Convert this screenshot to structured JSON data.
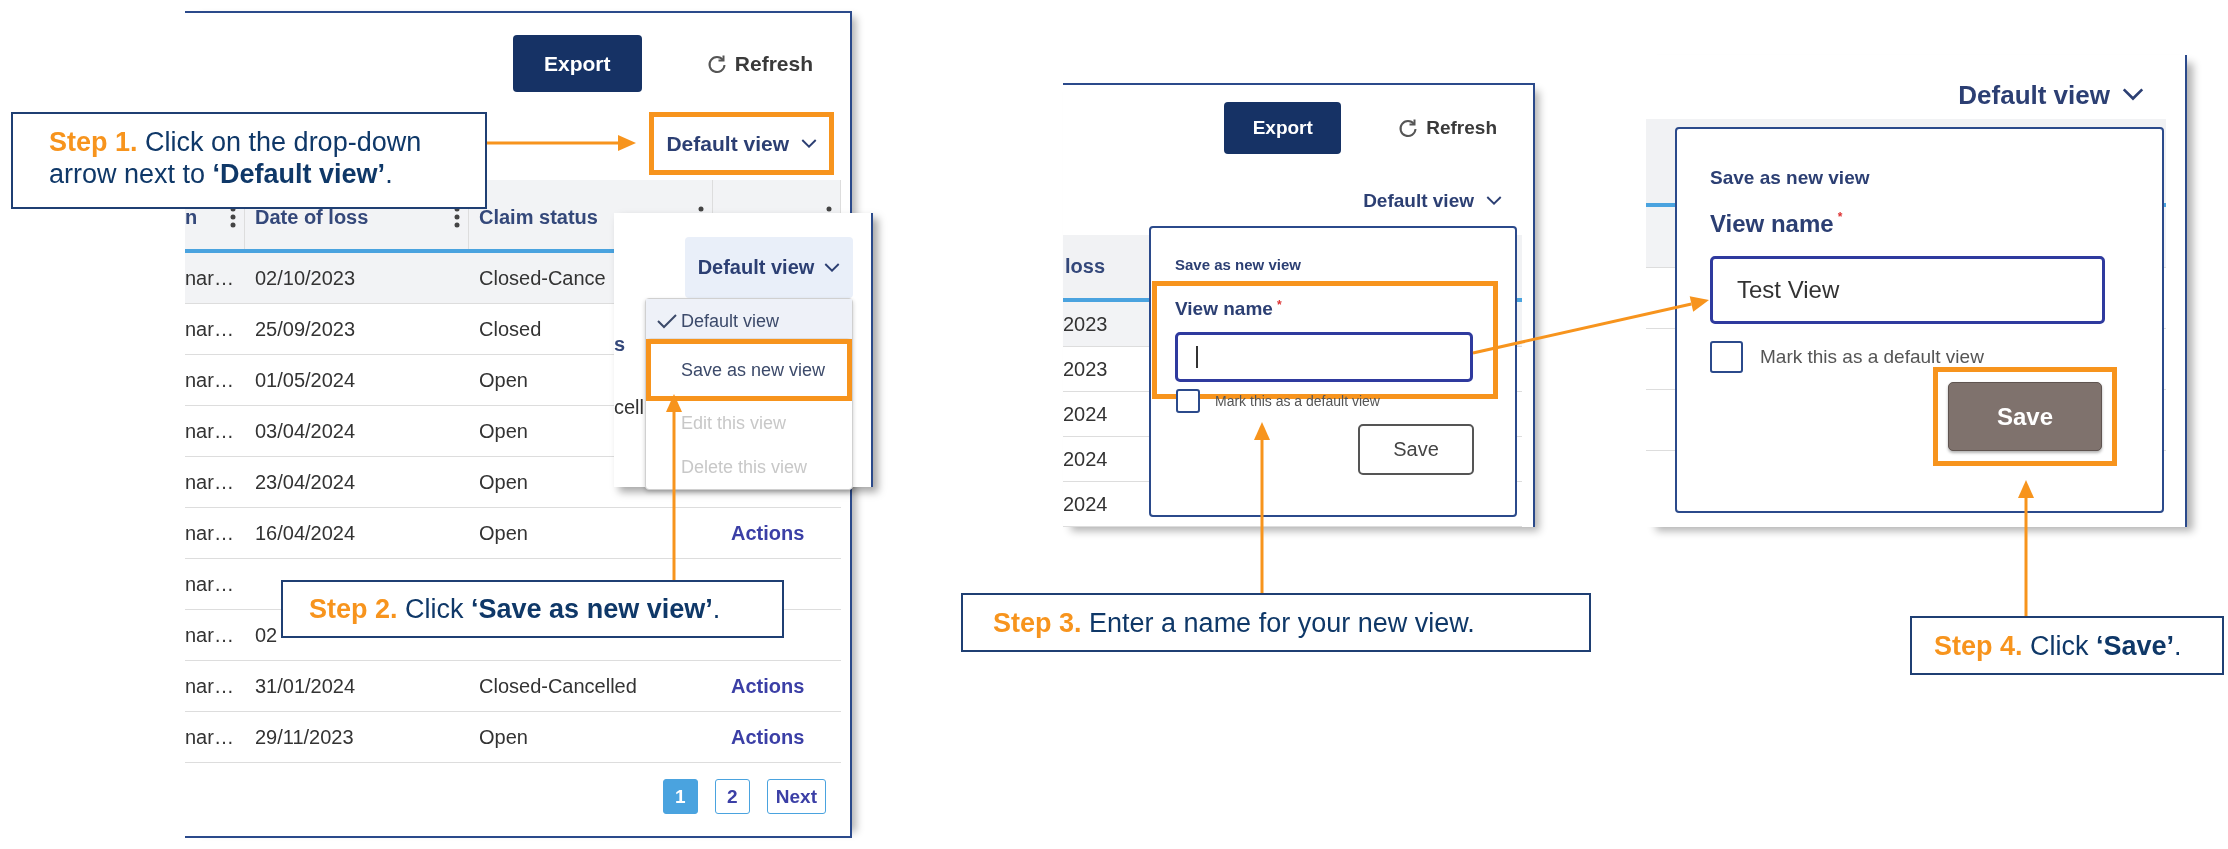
{
  "guide_steps": [
    {
      "label": "Step 1.",
      "text": "Click on the drop-down arrow next to **‘Default view’**."
    },
    {
      "label": "Step 2.",
      "text": "Click **‘Save as new view’**."
    },
    {
      "label": "Step 3.",
      "text": "Enter a name for your new view."
    },
    {
      "label": "Step 4.",
      "text": "Click **‘Save’**."
    }
  ],
  "screen_1": {
    "export_button": "Export",
    "refresh_button": "Refresh",
    "view_selector": {
      "label": "Default view",
      "highlighted": true
    },
    "table": {
      "columns": [
        "n",
        "Date of loss",
        "Claim status"
      ],
      "rows": [
        {
          "cells": [
            "nar…",
            "02/10/2023",
            "Closed-Cance"
          ],
          "hovered": true
        },
        {
          "cells": [
            "nar…",
            "25/09/2023",
            "Closed"
          ],
          "hovered": false
        },
        {
          "cells": [
            "nar…",
            "01/05/2024",
            "Open"
          ],
          "hovered": false
        },
        {
          "cells": [
            "nar…",
            "03/04/2024",
            "Open"
          ],
          "hovered": false
        },
        {
          "cells": [
            "nar…",
            "23/04/2024",
            "Open"
          ],
          "hovered": false
        },
        {
          "cells": [
            "nar…",
            "16/04/2024",
            "Open"
          ],
          "action": "Actions",
          "hovered": false
        },
        {
          "cells": [
            "nar…"
          ],
          "hovered": false
        },
        {
          "cells": [
            "nar…",
            "02"
          ],
          "hovered": false
        },
        {
          "cells": [
            "nar…",
            "31/01/2024",
            "Closed-Cancelled"
          ],
          "action": "Actions",
          "hovered": false
        },
        {
          "cells": [
            "nar…",
            "29/11/2023",
            "Open"
          ],
          "action": "Actions",
          "hovered": false
        }
      ]
    },
    "pagination": [
      {
        "label": "1",
        "selected": true
      },
      {
        "label": "2",
        "selected": false
      },
      {
        "label": "Next",
        "selected": false
      }
    ],
    "view_menu": {
      "button": "Default view",
      "behind_texts": [
        "s",
        "cell"
      ],
      "items": [
        {
          "label": "Default view",
          "checked": true,
          "disabled": false,
          "highlighted": false
        },
        {
          "label": "Save as new view",
          "checked": false,
          "disabled": false,
          "highlighted": true
        },
        {
          "label": "Edit this view",
          "checked": false,
          "disabled": true,
          "highlighted": false
        },
        {
          "label": "Delete this view",
          "checked": false,
          "disabled": true,
          "highlighted": false
        }
      ]
    }
  },
  "screen_2": {
    "export_button": "Export",
    "refresh_button": "Refresh",
    "view_selector": {
      "label": "Default view",
      "highlighted": false
    },
    "table_cells": [
      "loss",
      "2023",
      "2023",
      "2024",
      "2024",
      "2024"
    ],
    "dialog": {
      "title": "Save as new view",
      "field_label": "View name",
      "required_mark": "*",
      "focused": true,
      "field_highlighted": true,
      "checkbox_label": "Mark this as a default view",
      "checked": false,
      "save_button": {
        "label": "Save",
        "kind": "outline",
        "highlighted": false
      }
    }
  },
  "screen_3": {
    "view_selector": {
      "label": "Default view",
      "highlighted": false
    },
    "dialog": {
      "title": "Save as new view",
      "field_label": "View name",
      "required_mark": "*",
      "value": "Test View",
      "focused": false,
      "field_highlighted": false,
      "checkbox_label": "Mark this as a default view",
      "checked": false,
      "save_button": {
        "label": "Save",
        "kind": "filled",
        "highlighted": true
      }
    }
  }
}
